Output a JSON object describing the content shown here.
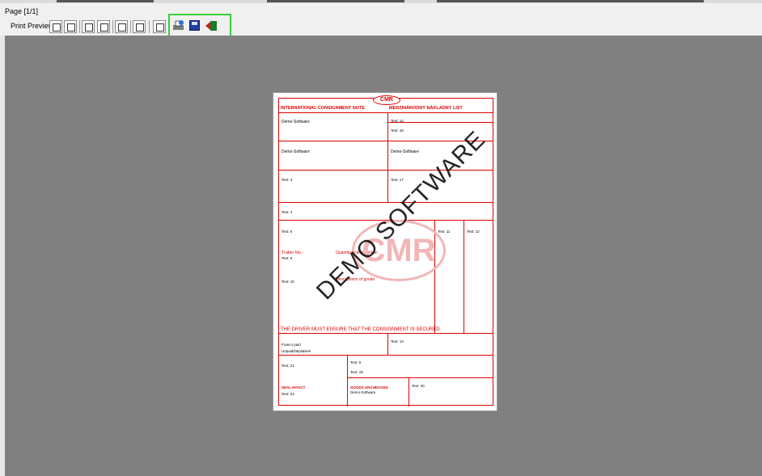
{
  "window": {
    "page_indicator": "Page [1/1]"
  },
  "toolbar": {
    "label": "Print Preview",
    "buttons": [
      "first-page",
      "previous-page",
      "next-page",
      "last-page",
      "go-to-page",
      "page-setup",
      "zoom",
      "print",
      "save",
      "exit"
    ]
  },
  "document": {
    "logo": "CMR",
    "header_left": "INTERNATIONAL CONSIGNMENT NOTE",
    "header_right": "MEDZINÁRODNÝ NÁKLADNÝ LIST",
    "sender_name": "Demo-Software",
    "carrier_code": "14",
    "carrier_text": "Text:   14",
    "field18": "Text:   18",
    "consignee_name": "Demo-Software",
    "carrier_name": "Demo-Software",
    "field3": "Text:   3",
    "field17": "Text:   17",
    "field4": "Text:   4",
    "field6": "Text:   6",
    "field11": "Text:   11",
    "field12": "Text:   12",
    "trailer_label": "Trailer No.:",
    "trailer_value": "Text:   5",
    "qty_label": "Quantity and/or contain",
    "desc_label": "Descriptions of goods",
    "field10": "Text:   10",
    "driver_note": "THE DRIVER MUST ENSURE THAT THE CONSIGNMENT IS SECURED",
    "franco": "Franco paid",
    "unpaid": "Unpaid/Neplatené",
    "field13": "Text:   13",
    "field22": "Text:   21",
    "field5": "Text:   5",
    "field19": "Text:   19",
    "seal": "SEAL INTACT",
    "goods_unchecked": "GOODS UNCHECKED",
    "demo_bottom": "Demo-Software",
    "field20": "Text:   20",
    "field24": "Text:   24",
    "watermark": "DEMO SOFTWARE"
  }
}
